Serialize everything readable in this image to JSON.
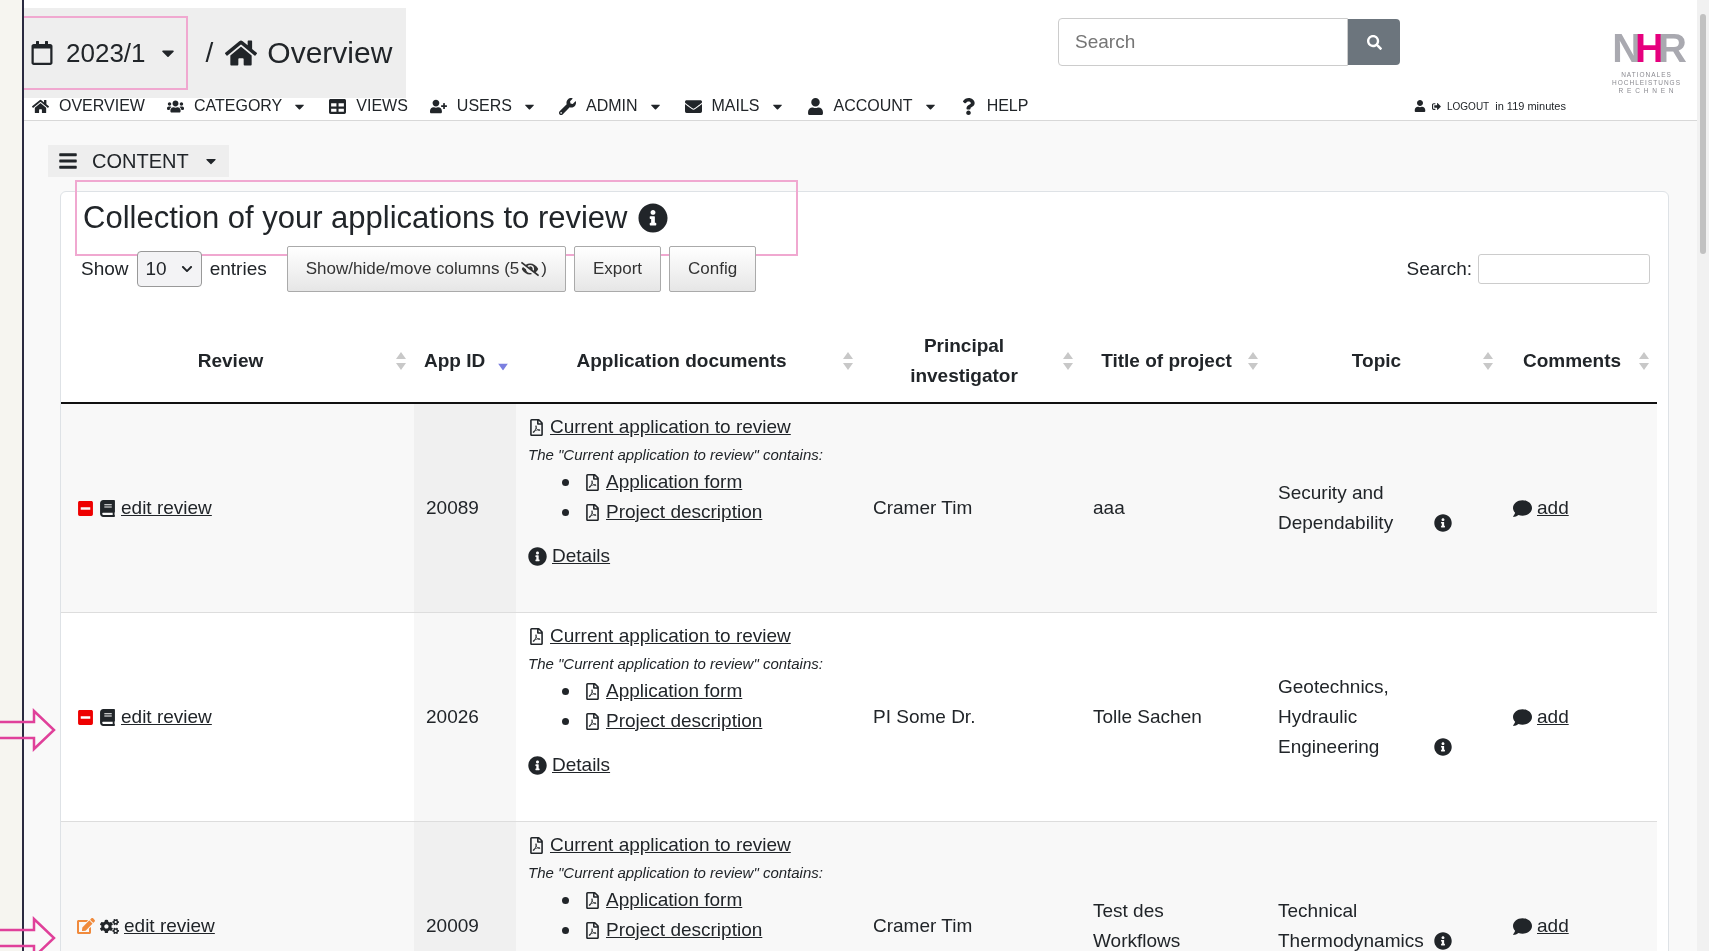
{
  "header": {
    "period": {
      "label": "2023/1",
      "highlighted": true
    },
    "separator": "/",
    "title": "Overview",
    "search": {
      "placeholder": "Search"
    },
    "logo": {
      "letters": [
        "N",
        "H",
        "R"
      ],
      "lines": [
        "NATIONALES",
        "HOCHLEISTUNGS",
        "R E C H N E N"
      ]
    }
  },
  "nav": [
    {
      "label": "OVERVIEW",
      "dropdown": false
    },
    {
      "label": "CATEGORY",
      "dropdown": true
    },
    {
      "label": "VIEWS",
      "dropdown": false
    },
    {
      "label": "USERS",
      "dropdown": true
    },
    {
      "label": "ADMIN",
      "dropdown": true
    },
    {
      "label": "MAILS",
      "dropdown": true
    },
    {
      "label": "ACCOUNT",
      "dropdown": true
    },
    {
      "label": "HELP",
      "dropdown": false
    }
  ],
  "session": {
    "logout": "LOGOUT",
    "remaining": "in 119 minutes"
  },
  "content_menu": {
    "label": "CONTENT"
  },
  "card": {
    "title": "Collection of your applications to review",
    "title_highlighted": true,
    "show": "Show",
    "page_size": "10",
    "entries": "entries",
    "columns_button": {
      "before": "Show/hide/move columns (5",
      "after": ")"
    },
    "buttons": [
      "Export",
      "Config"
    ],
    "search_label": "Search:"
  },
  "table": {
    "columns": [
      {
        "label": "Review",
        "sorted": false
      },
      {
        "label": "App ID",
        "sorted": true
      },
      {
        "label": "Application documents",
        "sorted": false
      },
      {
        "label": "Principal investigator",
        "sorted": false
      },
      {
        "label": "Title of project",
        "sorted": false
      },
      {
        "label": "Topic",
        "sorted": false
      },
      {
        "label": "Comments",
        "sorted": false
      }
    ],
    "rows": [
      {
        "marked": false,
        "review": {
          "kind": "closed",
          "link": "edit review"
        },
        "app_id": "20089",
        "documents": {
          "main": "Current application to review",
          "note": "The \"Current application to review\" contains:",
          "items": [
            "Application form",
            "Project description"
          ],
          "details": "Details"
        },
        "pi": "Cramer Tim",
        "title": "aaa",
        "topic": "Security and Dependability",
        "comment": "add"
      },
      {
        "marked": true,
        "review": {
          "kind": "closed",
          "link": "edit review"
        },
        "app_id": "20026",
        "documents": {
          "main": "Current application to review",
          "note": "The \"Current application to review\" contains:",
          "items": [
            "Application form",
            "Project description"
          ],
          "details": "Details"
        },
        "pi": "PI Some Dr.",
        "title": "Tolle Sachen",
        "topic": "Geotechnics, Hydraulic Engineering",
        "comment": "add"
      },
      {
        "marked": true,
        "review": {
          "kind": "open",
          "link": "edit review"
        },
        "app_id": "20009",
        "documents": {
          "main": "Current application to review",
          "note": "The \"Current application to review\" contains:",
          "items": [
            "Application form",
            "Project description"
          ]
        },
        "pi": "Cramer Tim",
        "title": "Test des Workflows",
        "topic": "Technical Thermodynamics",
        "comment": "add"
      }
    ]
  }
}
